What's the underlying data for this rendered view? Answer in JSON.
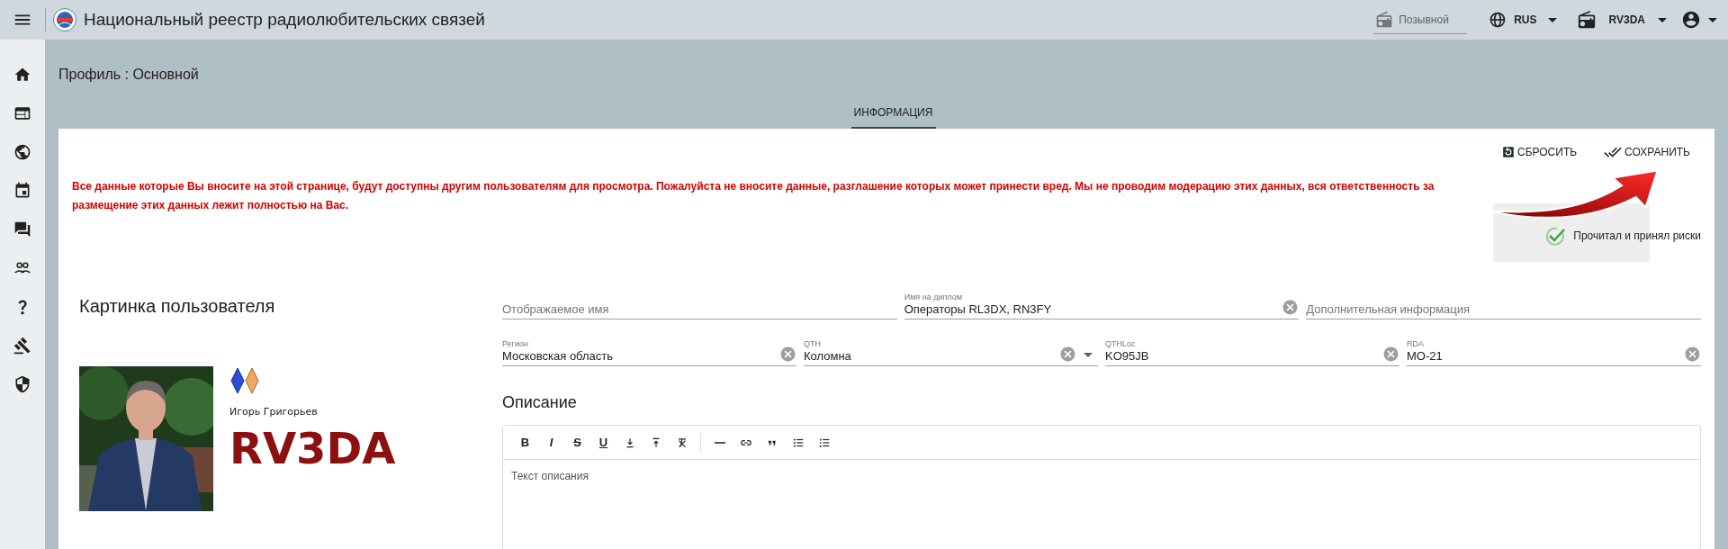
{
  "app_bar": {
    "title": "Национальный реестр радиолюбительских связей",
    "callsign_search": {
      "placeholder": "Позывной"
    },
    "language": "RUS",
    "station": "RV3DA"
  },
  "page": {
    "title": "Профиль : Основной",
    "tabs": [
      {
        "label": "ИНФОРМАЦИЯ",
        "selected": true
      }
    ]
  },
  "actions": [
    {
      "label": "СБРОСИТЬ",
      "kind": "reset"
    },
    {
      "label": "СОХРАНИТЬ",
      "kind": "save"
    }
  ],
  "warning": "Все данные которые Вы вносите на этой странице, будут доступны другим пользователям для просмотра. Пожалуйста не вносите данные, разглашение которых может принести вред. Мы не проводим модерацию этих данных, вся ответственность за размещение этих данных лежит полностью на Вас.",
  "risk_checkbox": {
    "label": "Прочитал и принял риски",
    "checked": true
  },
  "user_picture": {
    "heading": "Картинка пользователя",
    "name": "Игорь Григорьев",
    "callsign": "RV3DA"
  },
  "field_rows": [
    [
      {
        "placeholder": "Отображаемое имя"
      },
      {
        "label": "Имя на диплом",
        "value": "Операторы RL3DX, RN3FY",
        "clearable": true
      },
      {
        "placeholder": "Дополнительная информация"
      }
    ],
    [
      {
        "label": "Регион",
        "value": "Московская область",
        "clearable": true
      },
      {
        "label": "QTH",
        "value": "Коломна",
        "clearable": true,
        "dropdown": true
      },
      {
        "label": "QTHLoc",
        "value": "KO95JB",
        "clearable": true
      },
      {
        "label": "RDA",
        "value": "MO-21",
        "clearable": true
      }
    ]
  ],
  "description": {
    "heading": "Описание",
    "placeholder": "Текст описания",
    "toolbar": [
      {
        "kind": "bold",
        "glyph": "B"
      },
      {
        "kind": "italic",
        "glyph": "I"
      },
      {
        "kind": "strike",
        "glyph": "S"
      },
      {
        "kind": "underline",
        "glyph": "U"
      },
      {
        "kind": "subscript"
      },
      {
        "kind": "superscript"
      },
      {
        "kind": "clear"
      },
      {
        "kind": "separator"
      },
      {
        "kind": "rule"
      },
      {
        "kind": "link"
      },
      {
        "kind": "quote"
      },
      {
        "kind": "bullets"
      },
      {
        "kind": "numbers"
      }
    ]
  }
}
